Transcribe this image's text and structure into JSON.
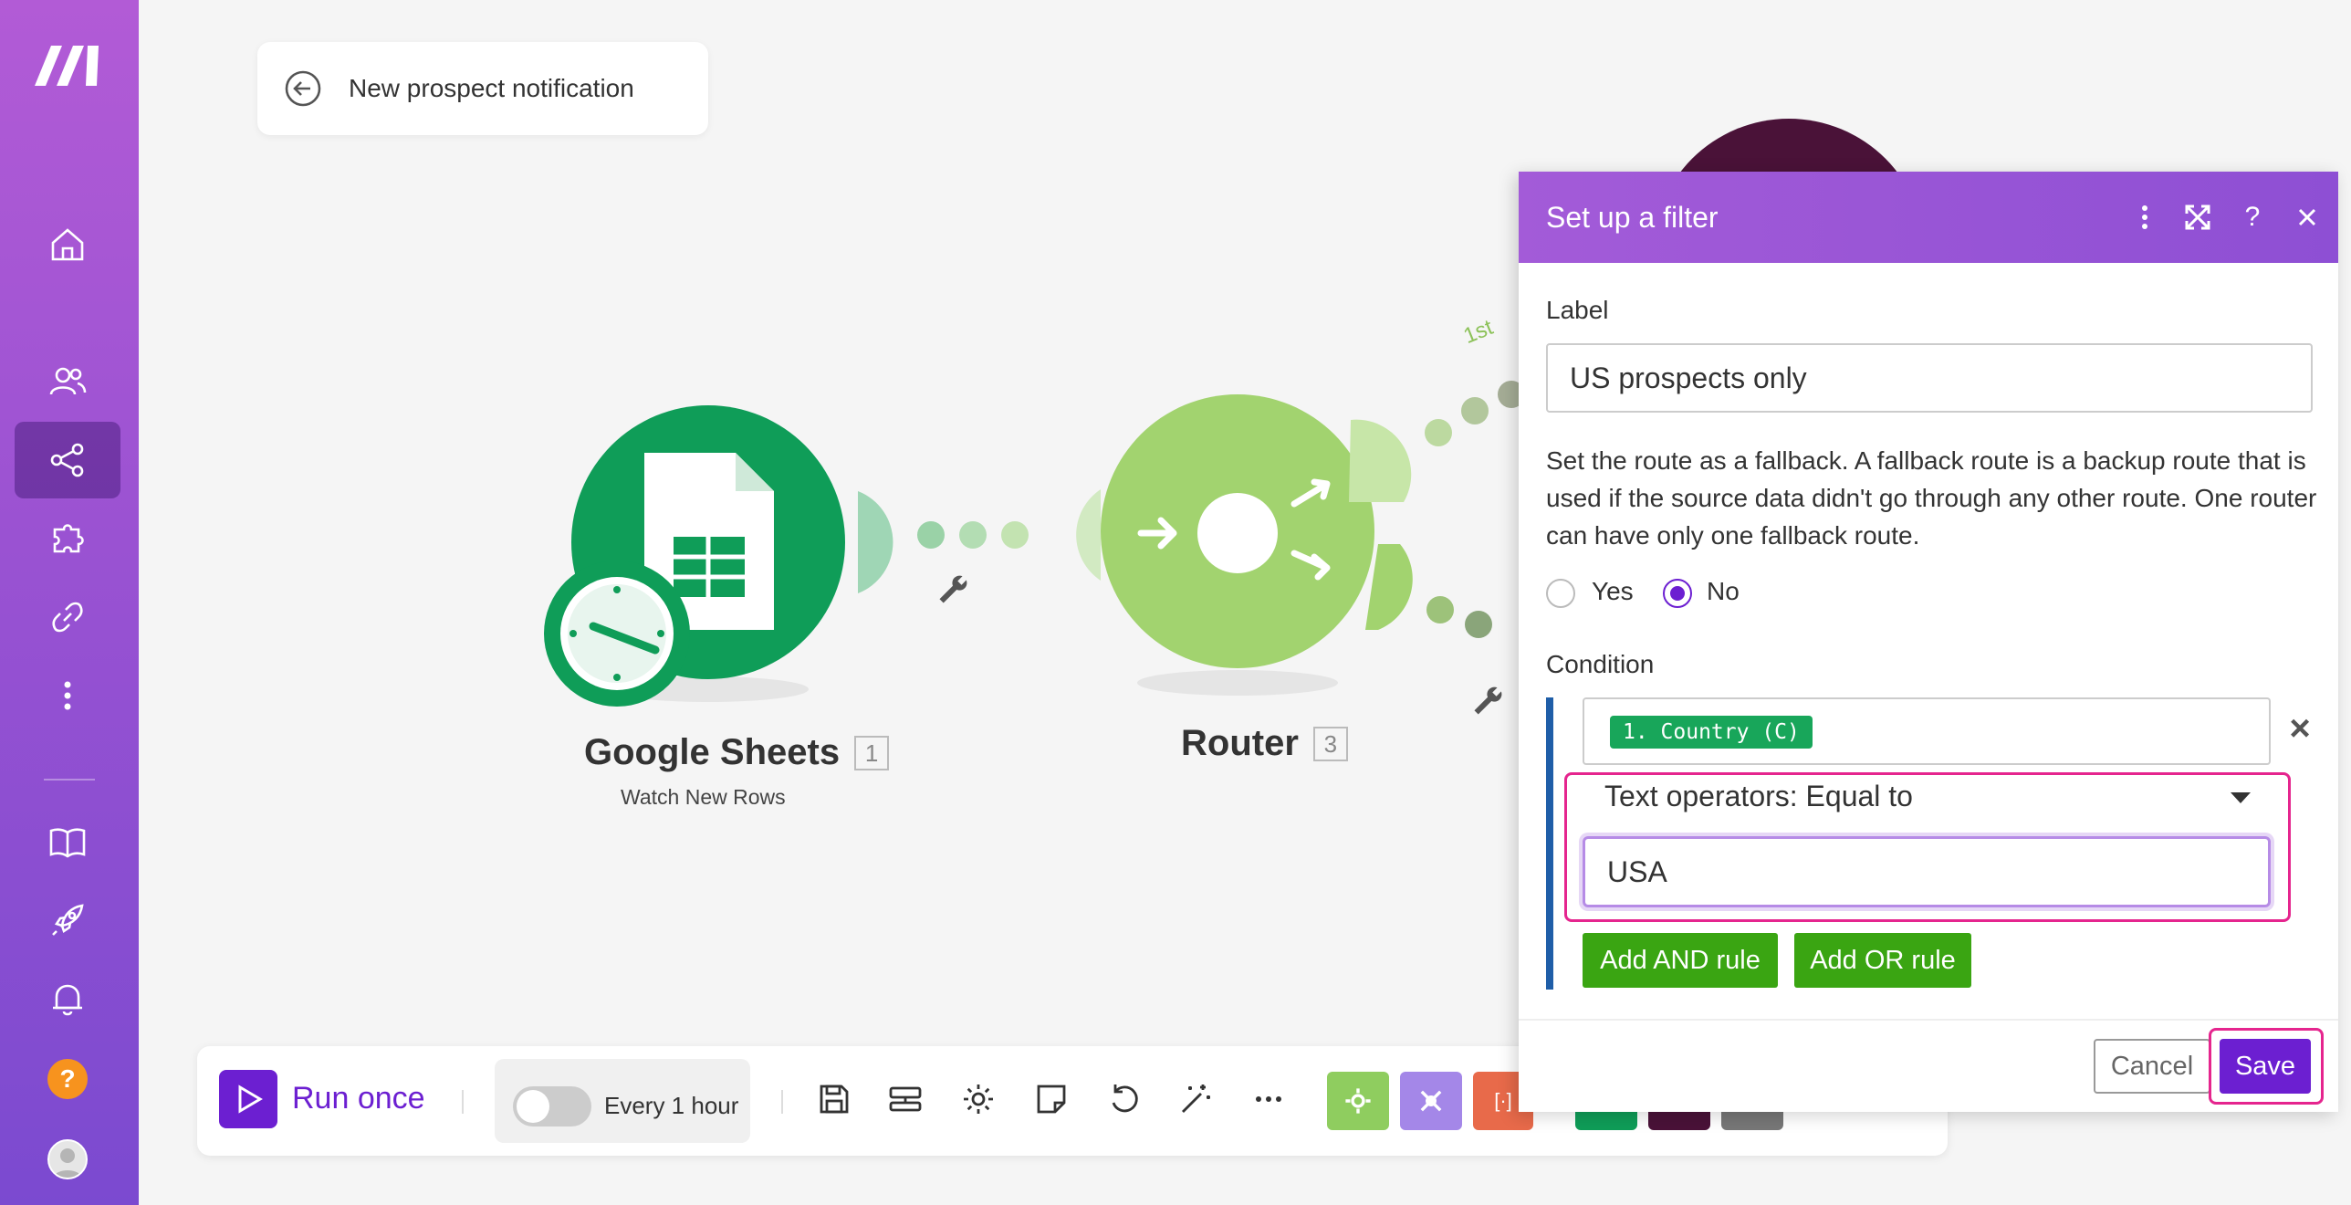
{
  "scenario": {
    "title": "New prospect notification"
  },
  "canvas": {
    "route_label": "1st",
    "nodes": [
      {
        "title": "Google Sheets",
        "number": "1",
        "subtitle": "Watch New Rows"
      },
      {
        "title": "Router",
        "number": "3"
      }
    ]
  },
  "toolbar": {
    "run_label": "Run once",
    "schedule_label": "Every 1 hour"
  },
  "filter_panel": {
    "title": "Set up a filter",
    "label_caption": "Label",
    "label_value": "US prospects only",
    "fallback_description": "Set the route as a fallback. A fallback route is a backup route that is used if the source data didn't go through any other route. One router can have only one fallback route.",
    "fallback_options": {
      "yes": "Yes",
      "no": "No",
      "selected": "No"
    },
    "condition_caption": "Condition",
    "condition_field_chip": "1. Country (C)",
    "operator": "Text operators: Equal to",
    "value": "USA",
    "add_and_rule": "Add AND rule",
    "add_or_rule": "Add OR rule",
    "cancel_label": "Cancel",
    "save_label": "Save"
  },
  "colors": {
    "brand_purple": "#6c1fd1",
    "sheets_green": "#0f9d58",
    "router_green": "#a2d36f",
    "button_green": "#3aa512",
    "highlight_pink": "#e5258e"
  }
}
